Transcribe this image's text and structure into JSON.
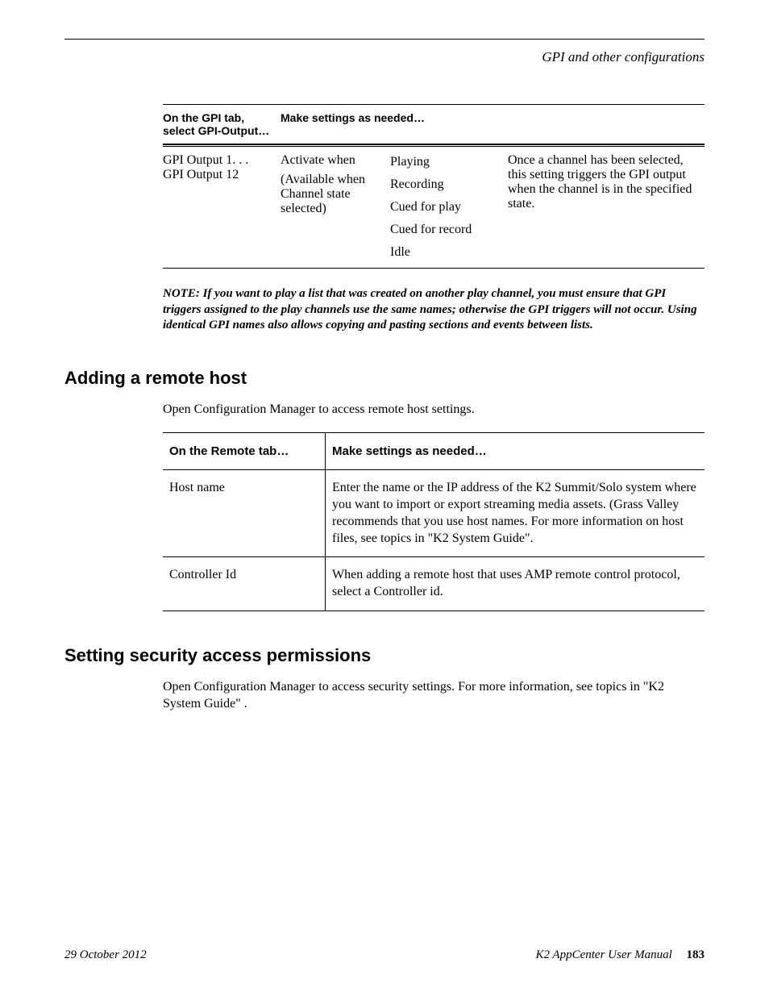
{
  "running_head": "GPI and other configurations",
  "table1": {
    "head_col1_line1": "On the GPI tab,",
    "head_col1_line2": "select GPI-Output…",
    "head_col2": "Make settings as needed…",
    "col1_line1": "GPI Output 1. . .",
    "col1_line2": "GPI Output 12",
    "col2a_line1": "Activate when",
    "col2a_line2": "(Available when Channel state selected)",
    "states": [
      "Playing",
      "Recording",
      "Cued for play",
      "Cued for record",
      "Idle"
    ],
    "col3": "Once a channel has been selected, this setting triggers the GPI output when the channel is in the specified state."
  },
  "note": {
    "label": "NOTE:",
    "text": "If you want to play a list that was created on another play channel, you must ensure that GPI triggers assigned to the play channels use the same names; otherwise the GPI triggers will not occur. Using identical GPI names also allows copying and pasting sections and events between lists."
  },
  "section_remote": {
    "heading": "Adding a remote host",
    "intro": "Open Configuration Manager to access remote host settings.",
    "head_col1": "On the Remote tab…",
    "head_col2": "Make settings as needed…",
    "rows": [
      {
        "label": "Host name",
        "desc": "Enter the name or the IP address of the K2 Summit/Solo system where you want to import or export streaming media assets. (Grass Valley recommends that you use host names. For more information on host files, see topics in \"K2 System Guide\"."
      },
      {
        "label": "Controller Id",
        "desc": "When adding a remote host that uses AMP remote control protocol, select a Controller id."
      }
    ]
  },
  "section_security": {
    "heading": "Setting security access permissions",
    "body": "Open Configuration Manager to access security settings. For more information, see topics in \"K2 System Guide\" ."
  },
  "footer": {
    "date": "29 October 2012",
    "manual": "K2 AppCenter User Manual",
    "page": "183"
  }
}
